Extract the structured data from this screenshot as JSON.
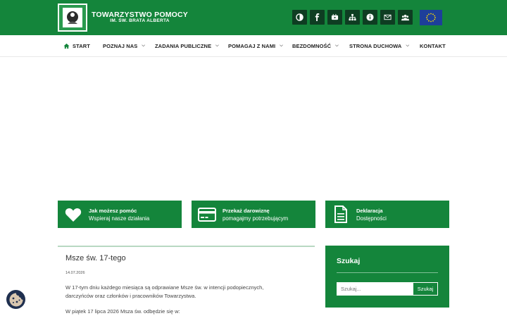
{
  "header": {
    "logo_line1": "TOWARZYSTWO POMOCY",
    "logo_line2": "IM. ŚW. BRATA ALBERTA",
    "icons": [
      "contrast-icon",
      "facebook-icon",
      "youtube-icon",
      "sitemap-icon",
      "info-icon",
      "mail-icon",
      "users-icon"
    ],
    "eu_flag": "eu-flag-icon",
    "colors": {
      "brand_green": "#14853b",
      "icon_bg": "#0e3d22"
    }
  },
  "nav": {
    "items": [
      {
        "label": "START"
      },
      {
        "label": "POZNAJ NAS"
      },
      {
        "label": "ZADANIA PUBLICZNE"
      },
      {
        "label": "POMAGAJ Z NAMI"
      },
      {
        "label": "BEZDOMNOŚĆ"
      },
      {
        "label": "STRONA DUCHOWA"
      },
      {
        "label": "KONTAKT"
      }
    ]
  },
  "cards": [
    {
      "title": "Jak możesz pomóc",
      "subtitle": "Wspieraj nasze działania",
      "icon": "heart-icon"
    },
    {
      "title": "Przekaż darowiznę",
      "subtitle": "pomagajmy potrzebującym",
      "icon": "credit-card-icon"
    },
    {
      "title": "Deklaracja",
      "subtitle": "Dostępności",
      "icon": "document-icon"
    }
  ],
  "article": {
    "title": "Msze św. 17-tego",
    "date": "14.07.2026",
    "p1": "W 17-tym dniu każdego miesiąca są odprawiane Msze św. w intencji podopiecznych, darczyńców oraz członków i pracowników Towarzystwa.",
    "p2": "W piątek 17 lipca 2026 Msza św. odbędzie się w:"
  },
  "search": {
    "title": "Szukaj",
    "placeholder": "Szukaj...",
    "button": "Szukaj"
  }
}
